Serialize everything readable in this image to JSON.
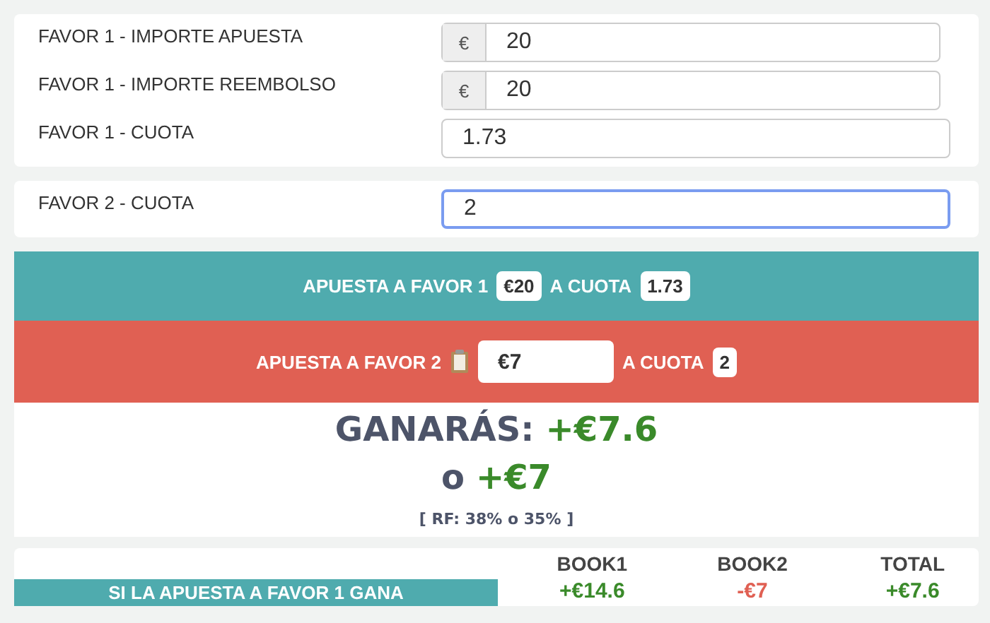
{
  "favor1_fields": [
    {
      "label": "FAVOR 1 - IMPORTE APUESTA",
      "prefix": "€",
      "value": "20"
    },
    {
      "label": "FAVOR 1 - IMPORTE REEMBOLSO",
      "prefix": "€",
      "value": "20"
    },
    {
      "label": "FAVOR 1 - CUOTA",
      "value": "1.73"
    }
  ],
  "favor2_field": {
    "label": "FAVOR 2 - CUOTA",
    "value": "2",
    "focused": true
  },
  "bet1": {
    "label": "APUESTA A FAVOR 1",
    "amount": "€20",
    "odds_label": "A CUOTA",
    "odds": "1.73"
  },
  "bet2": {
    "label": "APUESTA A FAVOR 2",
    "amount": "€7",
    "odds_label": "A CUOTA",
    "odds": "2"
  },
  "result": {
    "label": "GANARÁS:",
    "profit": "+€7.6",
    "or": "o",
    "profit_alt": "+€7",
    "rf": "[ RF: 38% o 35% ]"
  },
  "table": {
    "columns": [
      "BOOK1",
      "BOOK2",
      "TOTAL"
    ],
    "rows": [
      {
        "label": "SI LA APUESTA A FAVOR 1 GANA",
        "values": [
          {
            "text": "+€14.6",
            "positive": true
          },
          {
            "text": "-€7",
            "positive": false
          },
          {
            "text": "+€7.6",
            "positive": true
          }
        ]
      }
    ]
  }
}
